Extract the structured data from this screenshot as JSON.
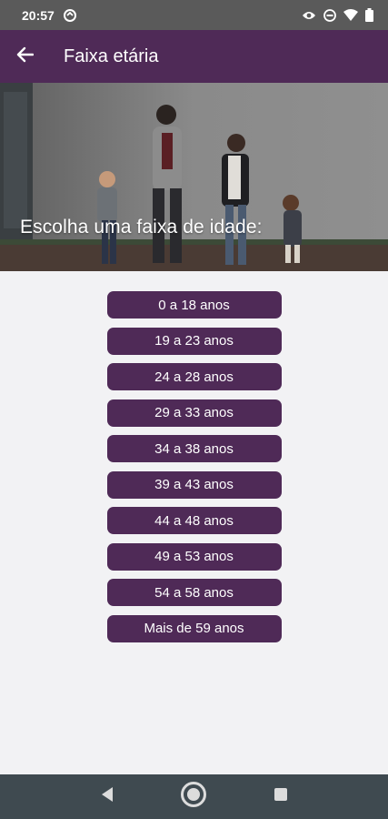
{
  "status_bar": {
    "time": "20:57",
    "icons": [
      "sync-icon",
      "eye-icon",
      "dnd-icon",
      "wifi-icon",
      "battery-icon"
    ]
  },
  "app_bar": {
    "title": "Faixa etária",
    "back_icon": "arrow-left-icon"
  },
  "hero": {
    "caption": "Escolha uma faixa de idade:"
  },
  "age_ranges": [
    "0 a 18 anos",
    "19 a 23 anos",
    "24 a 28 anos",
    "29 a 33 anos",
    "34 a 38 anos",
    "39 a 43 anos",
    "44 a 48 anos",
    "49 a 53 anos",
    "54 a 58 anos",
    "Mais de 59 anos"
  ],
  "nav_bar": {
    "icons": [
      "back-triangle-icon",
      "home-circle-icon",
      "recents-square-icon"
    ]
  },
  "colors": {
    "primary": "#4f2a57",
    "background": "#f2f2f4",
    "status_bar": "#5a5a5a",
    "nav_bar": "#3f4a50"
  }
}
